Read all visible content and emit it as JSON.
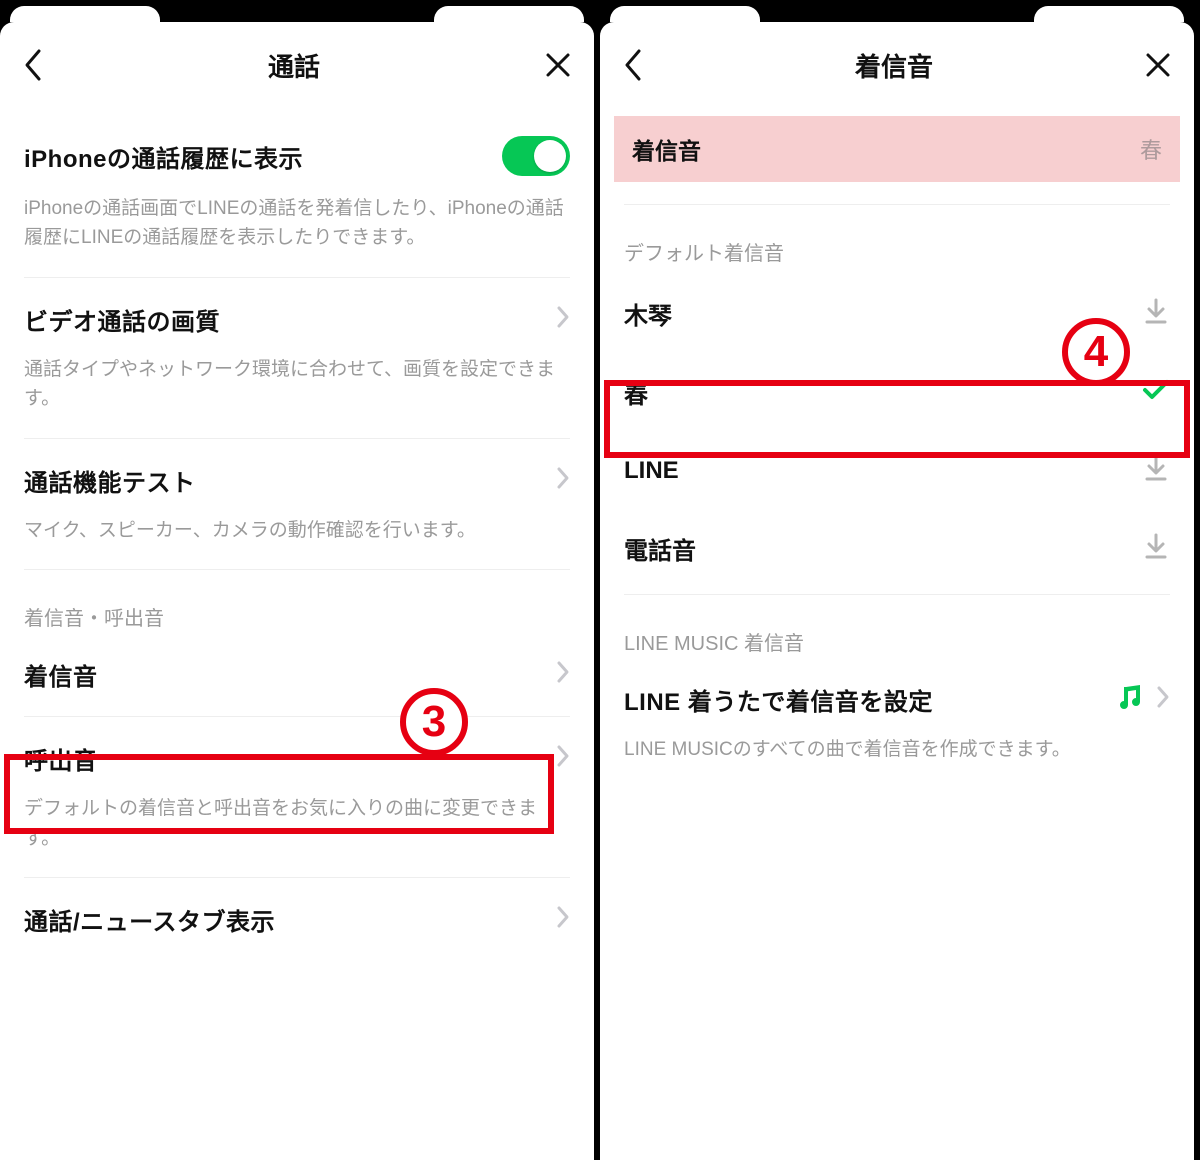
{
  "left": {
    "title": "通話",
    "row_iphone": "iPhoneの通話履歴に表示",
    "desc_iphone": "iPhoneの通話画面でLINEの通話を発着信したり、iPhoneの通話履歴にLINEの通話履歴を表示したりできます。",
    "row_video": "ビデオ通話の画質",
    "desc_video": "通話タイプやネットワーク環境に合わせて、画質を設定できます。",
    "row_test": "通話機能テスト",
    "desc_test": "マイク、スピーカー、カメラの動作確認を行います。",
    "section_ring": "着信音・呼出音",
    "row_ringtone": "着信音",
    "row_callout": "呼出音",
    "desc_ringcall": "デフォルトの着信音と呼出音をお気に入りの曲に変更できます。",
    "row_tabs": "通話/ニュースタブ表示"
  },
  "right": {
    "title": "着信音",
    "hl_label": "着信音",
    "hl_value": "春",
    "section_default": "デフォルト着信音",
    "tones": {
      "0": "木琴",
      "1": "春",
      "2": "LINE",
      "3": "電話音"
    },
    "section_music": "LINE MUSIC 着信音",
    "music_row": "LINE 着うたで着信音を設定",
    "music_desc": "LINE MUSICのすべての曲で着信音を作成できます。"
  },
  "anno": {
    "n3": "3",
    "n4": "4"
  }
}
